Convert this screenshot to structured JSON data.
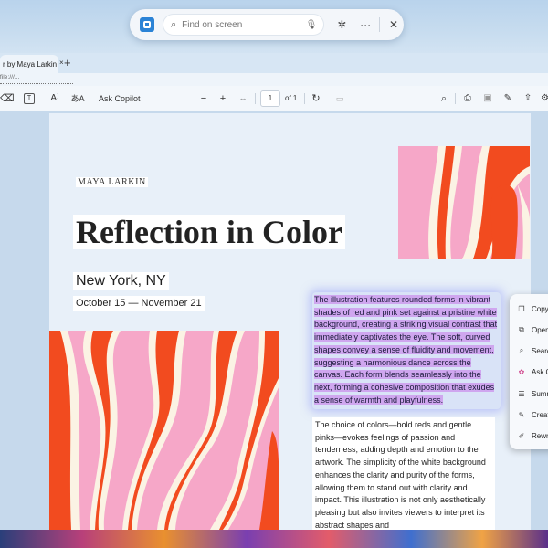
{
  "findbar": {
    "placeholder": "Find on screen",
    "icons": [
      "app-icon",
      "search-icon",
      "mic-icon",
      "perplexity-icon",
      "more-icon",
      "close-icon"
    ]
  },
  "browser": {
    "tab_title": "r by Maya Larkin",
    "tab_close": "×",
    "new_tab": "+",
    "address": "file:///..."
  },
  "toolbar": {
    "ask_copilot": "Ask Copilot",
    "zoom_out": "−",
    "zoom_in": "+",
    "page_number": "1",
    "page_total": "of 1"
  },
  "document": {
    "eyebrow": "MAYA LARKIN",
    "title": "Reflection in Color",
    "city": "New York, NY",
    "dates": "October 15 — November 21",
    "paragraph1": "The illustration features rounded forms in vibrant shades of red and pink set against a pristine white background, creating a striking visual contrast that immediately captivates the eye. The soft, curved shapes convey a sense of fluidity and movement, suggesting a harmonious dance across the canvas. Each form blends seamlessly into the next, forming a cohesive composition that exudes a sense of warmth and playfulness.",
    "paragraph2": "The choice of colors—bold reds and gentle pinks—evokes feelings of passion and tenderness, adding depth and emotion to the artwork. The simplicity of the white background enhances the clarity and purity of the forms, allowing them to stand out with clarity and impact. This illustration is not only aesthetically pleasing but also invites viewers to interpret its abstract shapes and",
    "art_colors": {
      "pink": "#f6a7c8",
      "red": "#f24b1f",
      "cream": "#fbf3e4"
    }
  },
  "context_menu": {
    "items": [
      {
        "label": "Copy",
        "icon": "copy-icon"
      },
      {
        "label": "Open",
        "icon": "open-icon"
      },
      {
        "label": "Search",
        "icon": "search-icon"
      },
      {
        "label": "Ask C",
        "icon": "copilot-icon"
      },
      {
        "label": "Summ",
        "icon": "summarize-icon"
      },
      {
        "label": "Creat",
        "icon": "create-icon"
      },
      {
        "label": "Rewri",
        "icon": "rewrite-icon"
      }
    ]
  }
}
